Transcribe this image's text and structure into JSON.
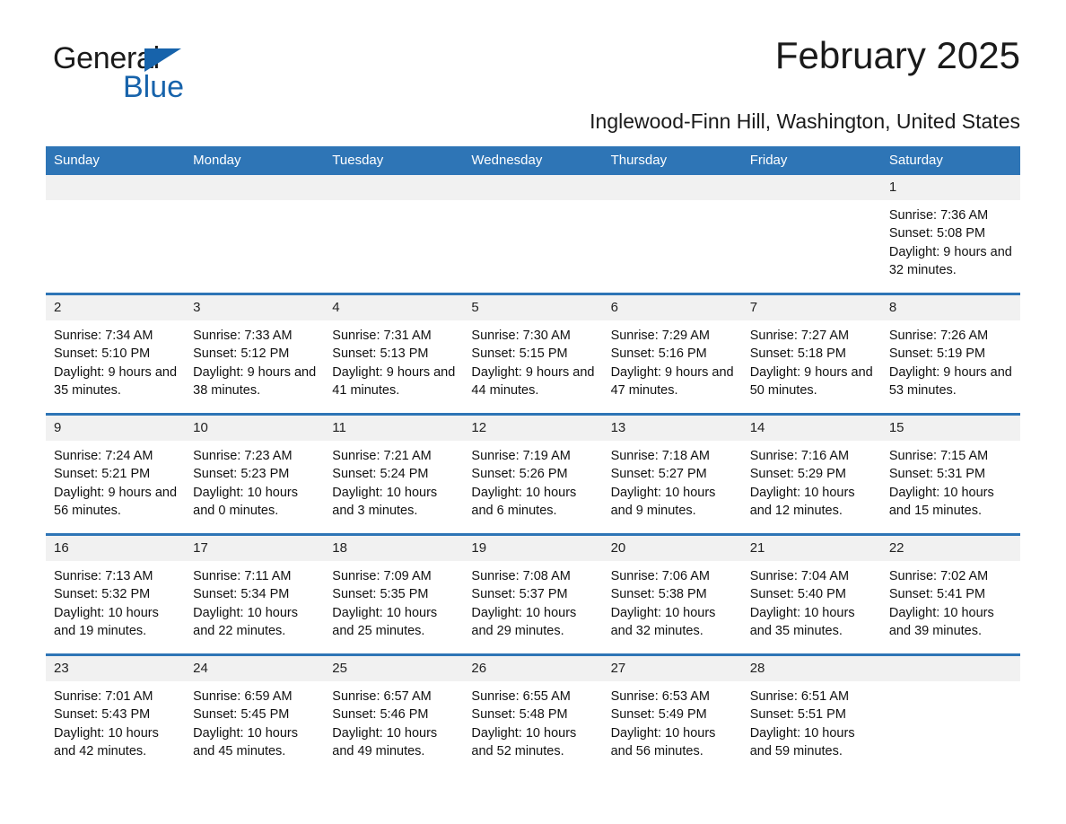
{
  "brand": {
    "word_general": "General",
    "word_blue": "Blue",
    "accent_color": "#1763ab"
  },
  "header": {
    "month_title": "February 2025",
    "subtitle": "Inglewood-Finn Hill, Washington, United States"
  },
  "calendar": {
    "header_bg": "#2E75B6",
    "daynum_bg": "#f1f1f1",
    "weekdays": [
      "Sunday",
      "Monday",
      "Tuesday",
      "Wednesday",
      "Thursday",
      "Friday",
      "Saturday"
    ],
    "weeks": [
      {
        "days": [
          {
            "num": "",
            "empty": true
          },
          {
            "num": "",
            "empty": true
          },
          {
            "num": "",
            "empty": true
          },
          {
            "num": "",
            "empty": true
          },
          {
            "num": "",
            "empty": true
          },
          {
            "num": "",
            "empty": true
          },
          {
            "num": "1",
            "sunrise": "Sunrise: 7:36 AM",
            "sunset": "Sunset: 5:08 PM",
            "daylight": "Daylight: 9 hours and 32 minutes."
          }
        ]
      },
      {
        "days": [
          {
            "num": "2",
            "sunrise": "Sunrise: 7:34 AM",
            "sunset": "Sunset: 5:10 PM",
            "daylight": "Daylight: 9 hours and 35 minutes."
          },
          {
            "num": "3",
            "sunrise": "Sunrise: 7:33 AM",
            "sunset": "Sunset: 5:12 PM",
            "daylight": "Daylight: 9 hours and 38 minutes."
          },
          {
            "num": "4",
            "sunrise": "Sunrise: 7:31 AM",
            "sunset": "Sunset: 5:13 PM",
            "daylight": "Daylight: 9 hours and 41 minutes."
          },
          {
            "num": "5",
            "sunrise": "Sunrise: 7:30 AM",
            "sunset": "Sunset: 5:15 PM",
            "daylight": "Daylight: 9 hours and 44 minutes."
          },
          {
            "num": "6",
            "sunrise": "Sunrise: 7:29 AM",
            "sunset": "Sunset: 5:16 PM",
            "daylight": "Daylight: 9 hours and 47 minutes."
          },
          {
            "num": "7",
            "sunrise": "Sunrise: 7:27 AM",
            "sunset": "Sunset: 5:18 PM",
            "daylight": "Daylight: 9 hours and 50 minutes."
          },
          {
            "num": "8",
            "sunrise": "Sunrise: 7:26 AM",
            "sunset": "Sunset: 5:19 PM",
            "daylight": "Daylight: 9 hours and 53 minutes."
          }
        ]
      },
      {
        "days": [
          {
            "num": "9",
            "sunrise": "Sunrise: 7:24 AM",
            "sunset": "Sunset: 5:21 PM",
            "daylight": "Daylight: 9 hours and 56 minutes."
          },
          {
            "num": "10",
            "sunrise": "Sunrise: 7:23 AM",
            "sunset": "Sunset: 5:23 PM",
            "daylight": "Daylight: 10 hours and 0 minutes."
          },
          {
            "num": "11",
            "sunrise": "Sunrise: 7:21 AM",
            "sunset": "Sunset: 5:24 PM",
            "daylight": "Daylight: 10 hours and 3 minutes."
          },
          {
            "num": "12",
            "sunrise": "Sunrise: 7:19 AM",
            "sunset": "Sunset: 5:26 PM",
            "daylight": "Daylight: 10 hours and 6 minutes."
          },
          {
            "num": "13",
            "sunrise": "Sunrise: 7:18 AM",
            "sunset": "Sunset: 5:27 PM",
            "daylight": "Daylight: 10 hours and 9 minutes."
          },
          {
            "num": "14",
            "sunrise": "Sunrise: 7:16 AM",
            "sunset": "Sunset: 5:29 PM",
            "daylight": "Daylight: 10 hours and 12 minutes."
          },
          {
            "num": "15",
            "sunrise": "Sunrise: 7:15 AM",
            "sunset": "Sunset: 5:31 PM",
            "daylight": "Daylight: 10 hours and 15 minutes."
          }
        ]
      },
      {
        "days": [
          {
            "num": "16",
            "sunrise": "Sunrise: 7:13 AM",
            "sunset": "Sunset: 5:32 PM",
            "daylight": "Daylight: 10 hours and 19 minutes."
          },
          {
            "num": "17",
            "sunrise": "Sunrise: 7:11 AM",
            "sunset": "Sunset: 5:34 PM",
            "daylight": "Daylight: 10 hours and 22 minutes."
          },
          {
            "num": "18",
            "sunrise": "Sunrise: 7:09 AM",
            "sunset": "Sunset: 5:35 PM",
            "daylight": "Daylight: 10 hours and 25 minutes."
          },
          {
            "num": "19",
            "sunrise": "Sunrise: 7:08 AM",
            "sunset": "Sunset: 5:37 PM",
            "daylight": "Daylight: 10 hours and 29 minutes."
          },
          {
            "num": "20",
            "sunrise": "Sunrise: 7:06 AM",
            "sunset": "Sunset: 5:38 PM",
            "daylight": "Daylight: 10 hours and 32 minutes."
          },
          {
            "num": "21",
            "sunrise": "Sunrise: 7:04 AM",
            "sunset": "Sunset: 5:40 PM",
            "daylight": "Daylight: 10 hours and 35 minutes."
          },
          {
            "num": "22",
            "sunrise": "Sunrise: 7:02 AM",
            "sunset": "Sunset: 5:41 PM",
            "daylight": "Daylight: 10 hours and 39 minutes."
          }
        ]
      },
      {
        "days": [
          {
            "num": "23",
            "sunrise": "Sunrise: 7:01 AM",
            "sunset": "Sunset: 5:43 PM",
            "daylight": "Daylight: 10 hours and 42 minutes."
          },
          {
            "num": "24",
            "sunrise": "Sunrise: 6:59 AM",
            "sunset": "Sunset: 5:45 PM",
            "daylight": "Daylight: 10 hours and 45 minutes."
          },
          {
            "num": "25",
            "sunrise": "Sunrise: 6:57 AM",
            "sunset": "Sunset: 5:46 PM",
            "daylight": "Daylight: 10 hours and 49 minutes."
          },
          {
            "num": "26",
            "sunrise": "Sunrise: 6:55 AM",
            "sunset": "Sunset: 5:48 PM",
            "daylight": "Daylight: 10 hours and 52 minutes."
          },
          {
            "num": "27",
            "sunrise": "Sunrise: 6:53 AM",
            "sunset": "Sunset: 5:49 PM",
            "daylight": "Daylight: 10 hours and 56 minutes."
          },
          {
            "num": "28",
            "sunrise": "Sunrise: 6:51 AM",
            "sunset": "Sunset: 5:51 PM",
            "daylight": "Daylight: 10 hours and 59 minutes."
          },
          {
            "num": "",
            "empty": true
          }
        ]
      }
    ]
  }
}
